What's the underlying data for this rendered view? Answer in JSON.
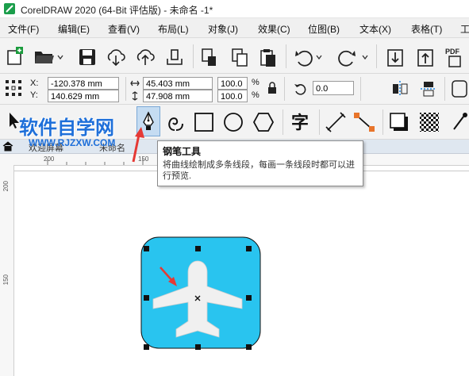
{
  "window": {
    "title": "CorelDRAW 2020 (64-Bit 评估版) - 未命名 -1*"
  },
  "menu": [
    "文件(F)",
    "编辑(E)",
    "查看(V)",
    "布局(L)",
    "对象(J)",
    "效果(C)",
    "位图(B)",
    "文本(X)",
    "表格(T)",
    "工"
  ],
  "property_bar": {
    "x_label": "X:",
    "y_label": "Y:",
    "x_value": "-120.378 mm",
    "y_value": "140.629 mm",
    "width_value": "45.403 mm",
    "height_value": "47.908 mm",
    "scale_x": "100.0",
    "scale_y": "100.0",
    "percent": "%",
    "rotation": "0.0"
  },
  "toolbox": {
    "text_tool_glyph": "字"
  },
  "document_tabs": [
    "欢迎屏幕",
    "未命名"
  ],
  "ruler": {
    "h_ticks": [
      "200",
      "150"
    ],
    "v_ticks": [
      "200",
      "150"
    ]
  },
  "tooltip": {
    "title": "钢笔工具",
    "body": "将曲线绘制成多条线段，每画一条线段时都可以进行预览."
  },
  "watermark": {
    "title": "软件自学网",
    "url": "WWW.RJZXW.COM"
  },
  "colors": {
    "icon_fill": "#29c4ef",
    "accent_arrow": "#e53935",
    "watermark": "#1e6fd9"
  }
}
